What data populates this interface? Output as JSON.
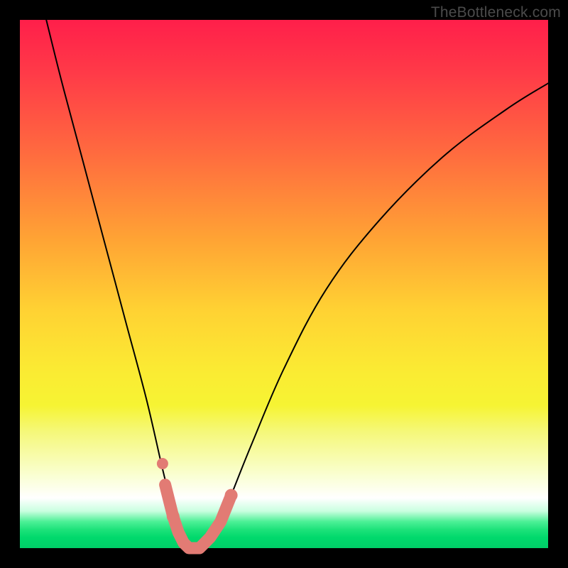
{
  "watermark": {
    "text": "TheBottleneck.com"
  },
  "chart_data": {
    "type": "line",
    "title": "",
    "xlabel": "",
    "ylabel": "",
    "xlim": [
      0,
      100
    ],
    "ylim": [
      0,
      100
    ],
    "series": [
      {
        "name": "bottleneck-curve",
        "x": [
          5,
          8,
          12,
          16,
          20,
          24,
          27,
          29,
          30,
          31,
          32,
          33,
          34,
          35,
          36,
          38,
          40,
          44,
          50,
          58,
          68,
          80,
          92,
          100
        ],
        "values": [
          100,
          88,
          73,
          58,
          43,
          28,
          15,
          7,
          3,
          1,
          0,
          0,
          0,
          1,
          2,
          5,
          10,
          20,
          34,
          49,
          62,
          74,
          83,
          88
        ]
      }
    ],
    "annotations": [
      {
        "name": "trough-marker",
        "type": "marker-strip",
        "color": "#e27b74",
        "points_x": [
          27.5,
          29,
          30,
          31,
          32,
          33,
          34,
          35,
          36,
          38,
          40
        ],
        "points_y": [
          12,
          6,
          3,
          1,
          0,
          0,
          0,
          1,
          2,
          5,
          10
        ]
      }
    ]
  }
}
